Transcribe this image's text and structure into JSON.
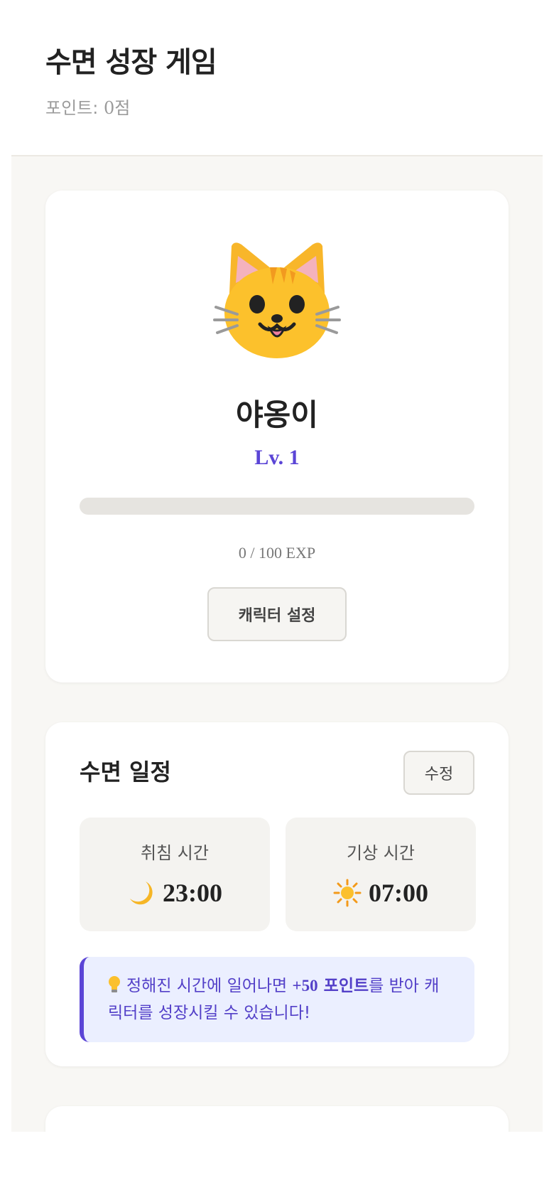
{
  "header": {
    "title": "수면 성장 게임",
    "points_prefix": "포인트: ",
    "points_value": "0",
    "points_suffix": "점"
  },
  "character": {
    "icon": "cat-face-icon",
    "name": "야옹이",
    "level": "Lv. 1",
    "exp_current": 0,
    "exp_max": 100,
    "exp_text": "0 / 100 EXP",
    "exp_fraction": 0,
    "settings_button": "캐릭터 설정"
  },
  "schedule": {
    "title": "수면 일정",
    "edit_button": "수정",
    "bedtime": {
      "label": "취침 시간",
      "icon": "crescent-moon-icon",
      "value": "23:00"
    },
    "wake": {
      "label": "기상 시간",
      "icon": "sun-icon",
      "value": "07:00"
    },
    "tip": {
      "icon": "light-bulb-icon",
      "text_before": "정해진 시간에 일어나면 ",
      "highlight_num": "+50",
      "highlight_text": " 포인트",
      "text_after": "를 받아 캐릭터를 성장시킬 수 있습니다!"
    }
  },
  "colors": {
    "accent": "#5b45d6",
    "tip_background": "#ebefff",
    "page_background": "#f8f7f4",
    "card_background": "#ffffff"
  }
}
